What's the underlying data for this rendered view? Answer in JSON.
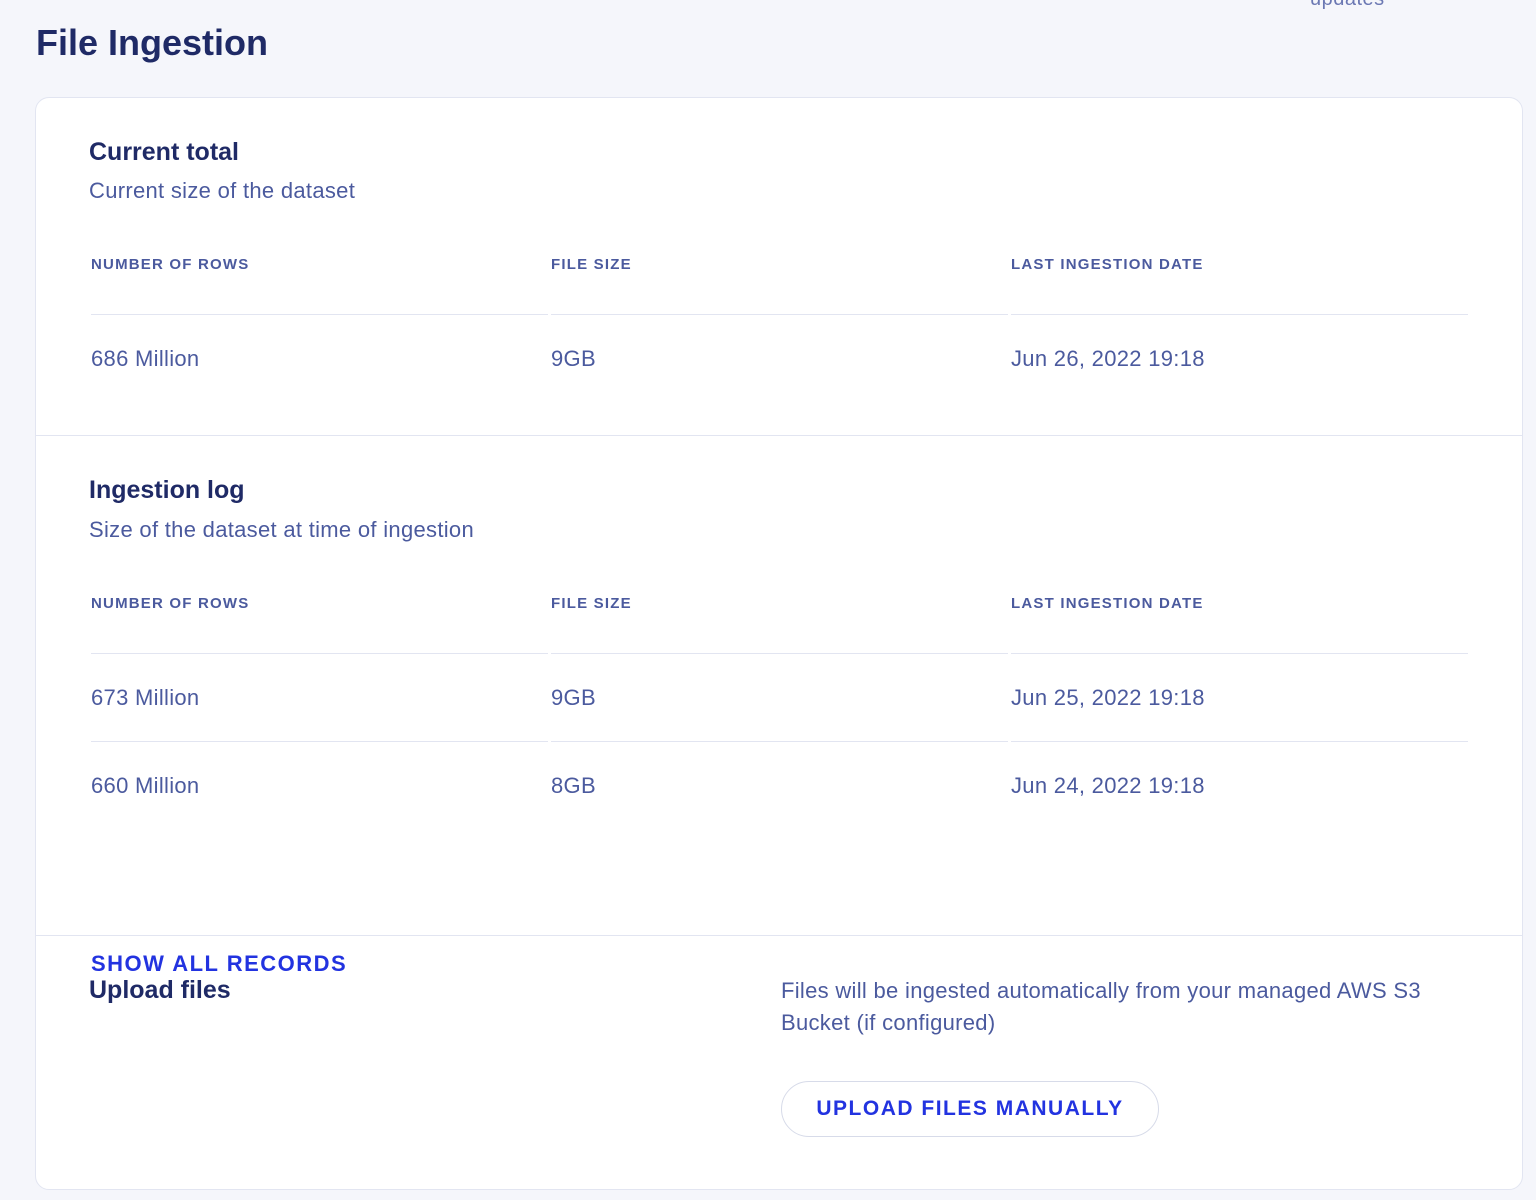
{
  "header": {
    "clipped_text": "updates",
    "title": "File Ingestion"
  },
  "current_total": {
    "title": "Current total",
    "subtitle": "Current size of the dataset",
    "columns": [
      "NUMBER OF ROWS",
      "FILE SIZE",
      "LAST INGESTION DATE"
    ],
    "rows": [
      [
        "686 Million",
        "9GB",
        "Jun 26, 2022 19:18"
      ]
    ]
  },
  "ingestion_log": {
    "title": "Ingestion log",
    "subtitle": "Size of the dataset at time of ingestion",
    "columns": [
      "NUMBER OF ROWS",
      "FILE SIZE",
      "LAST INGESTION DATE"
    ],
    "rows": [
      [
        "673 Million",
        "9GB",
        "Jun 25, 2022 19:18"
      ],
      [
        "660 Million",
        "8GB",
        "Jun 24, 2022 19:18"
      ]
    ],
    "show_all_label": "SHOW ALL RECORDS"
  },
  "upload": {
    "title": "Upload files",
    "description": "Files will be ingested automatically from your managed AWS S3 Bucket (if configured)",
    "button_label": "UPLOAD FILES MANUALLY"
  },
  "colors": {
    "heading": "#1f2a66",
    "text": "#4b5a9e",
    "accent": "#2233e0",
    "background": "#f5f6fb",
    "border": "#e2e5f1"
  }
}
